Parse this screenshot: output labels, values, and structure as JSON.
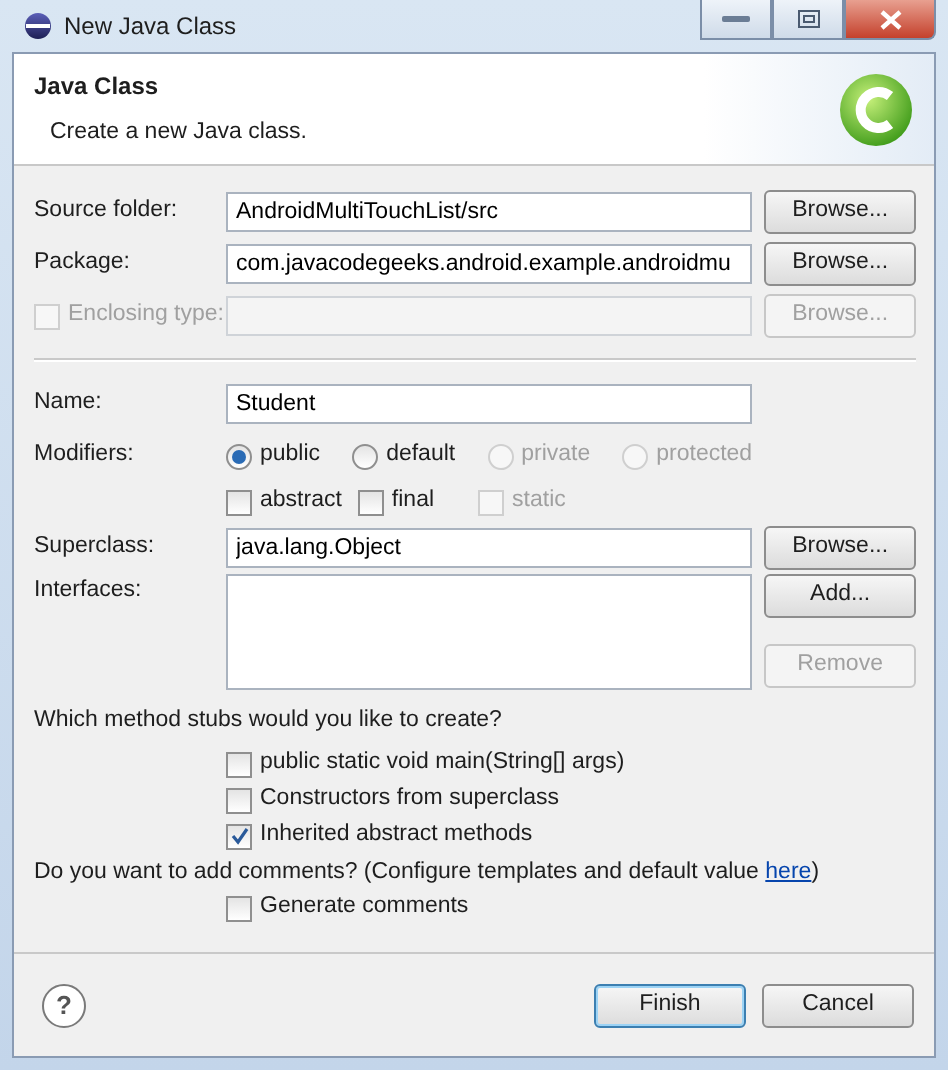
{
  "window": {
    "title": "New Java Class"
  },
  "header": {
    "title": "Java Class",
    "description": "Create a new Java class."
  },
  "location": [
    {
      "kind": "text",
      "label": "Source folder:",
      "value": "AndroidMultiTouchList/src",
      "disabled": false,
      "button": {
        "label": "Browse...",
        "disabled": false
      }
    },
    {
      "kind": "text",
      "label": "Package:",
      "value": "com.javacodegeeks.android.example.androidmu",
      "disabled": false,
      "button": {
        "label": "Browse...",
        "disabled": false
      }
    },
    {
      "kind": "checkbox",
      "label": "Enclosing type:",
      "checked": false,
      "disabled": true,
      "button": {
        "label": "Browse...",
        "disabled": true
      }
    }
  ],
  "name": {
    "label": "Name:",
    "value": "Student"
  },
  "modifiers": {
    "label": "Modifiers:",
    "access": [
      {
        "label": "public",
        "selected": true,
        "disabled": false
      },
      {
        "label": "default",
        "selected": false,
        "disabled": false
      },
      {
        "label": "private",
        "selected": false,
        "disabled": true
      },
      {
        "label": "protected",
        "selected": false,
        "disabled": true
      }
    ],
    "flags": [
      {
        "label": "abstract",
        "checked": false,
        "disabled": false
      },
      {
        "label": "final",
        "checked": false,
        "disabled": false
      },
      {
        "label": "static",
        "checked": false,
        "disabled": true
      }
    ]
  },
  "superclass": {
    "label": "Superclass:",
    "value": "java.lang.Object",
    "button": {
      "label": "Browse...",
      "disabled": false
    }
  },
  "interfaces": {
    "label": "Interfaces:",
    "buttons": [
      {
        "label": "Add...",
        "disabled": false
      },
      {
        "label": "Remove",
        "disabled": true
      }
    ]
  },
  "stubs": {
    "question": "Which method stubs would you like to create?",
    "options": [
      {
        "label": "public static void main(String[] args)",
        "checked": false
      },
      {
        "label": "Constructors from superclass",
        "checked": false
      },
      {
        "label": "Inherited abstract methods",
        "checked": true
      }
    ]
  },
  "comments": {
    "question": "Do you want to add comments? (Configure templates and default value ",
    "link": "here",
    "question_end": ")",
    "options": [
      {
        "label": "Generate comments",
        "checked": false
      }
    ]
  },
  "footer": {
    "help": "?",
    "buttons": [
      {
        "label": "Finish",
        "default": true
      },
      {
        "label": "Cancel",
        "default": false
      }
    ]
  }
}
